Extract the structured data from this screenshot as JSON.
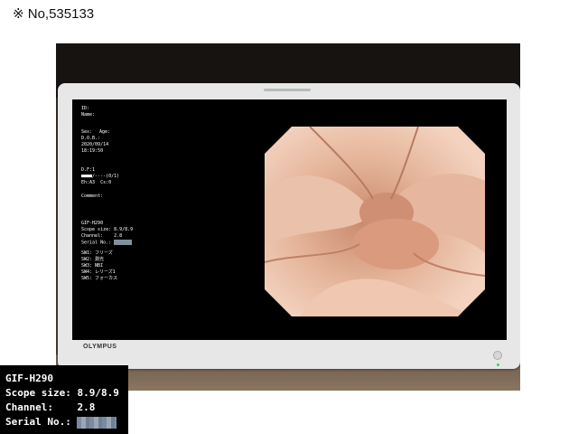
{
  "caption": "※ No,535133",
  "monitor": {
    "brand": "OLYMPUS"
  },
  "osd": {
    "id_label": "ID:",
    "name_label": "Name:",
    "sex_label": "Sex:",
    "age_label": "Age:",
    "dob_label": "D.O.B.:",
    "date": "2020/09/14",
    "time": "18:19:50",
    "df": "D.F:1",
    "ctr": "■■■■/----(0/1)",
    "eh": "Eh:A3  Cs:0",
    "comment_label": "Comment:",
    "scope_model": "GIF-H290",
    "scope_size": "Scope size: 8.9/8.9",
    "channel": "Channel:    2.8",
    "serial_label": "Serial No.:",
    "sw1": "SW1: フリーズ",
    "sw2": "SW2: 測光",
    "sw3": "SW3: NBI",
    "sw4": "SW4: レリーズ1",
    "sw5": "SW5: フォーカス"
  },
  "zoom_inset": {
    "model": "GIF-H290",
    "scope_size": "Scope size: 8.9/8.9",
    "channel": "Channel:    2.8",
    "serial_label": "Serial No.:"
  }
}
